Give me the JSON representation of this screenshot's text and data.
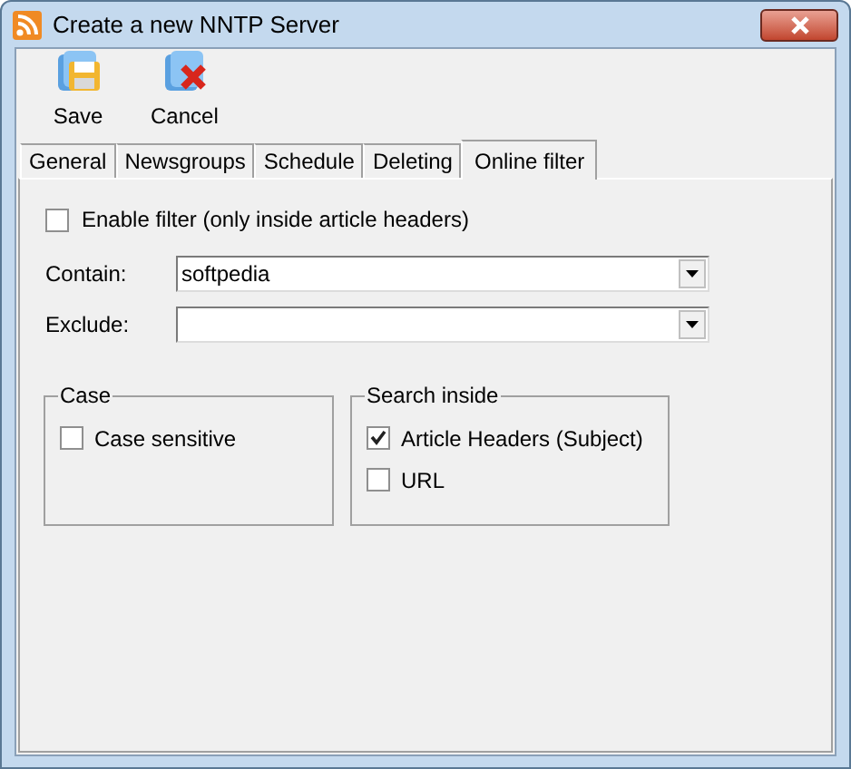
{
  "window": {
    "title": "Create a new NNTP Server"
  },
  "toolbar": [
    {
      "label": "Save",
      "kind": "save"
    },
    {
      "label": "Cancel",
      "kind": "cancel"
    }
  ],
  "tabs": [
    {
      "label": "General",
      "selected": false
    },
    {
      "label": "Newsgroups",
      "selected": false
    },
    {
      "label": "Schedule",
      "selected": false
    },
    {
      "label": "Deleting",
      "selected": false
    },
    {
      "label": "Online filter",
      "selected": true
    }
  ],
  "enable_filter": {
    "label": "Enable filter (only inside article headers)",
    "checked": false
  },
  "fields": [
    {
      "label": "Contain:",
      "value": "softpedia"
    },
    {
      "label": "Exclude:"
    }
  ],
  "groups": [
    {
      "title": "Case",
      "options": [
        {
          "label": "Case sensitive",
          "checked": false
        }
      ]
    },
    {
      "title": "Search inside",
      "options": [
        {
          "label": "Article Headers (Subject)",
          "checked": true
        },
        {
          "label": "URL",
          "checked": false
        }
      ]
    }
  ]
}
